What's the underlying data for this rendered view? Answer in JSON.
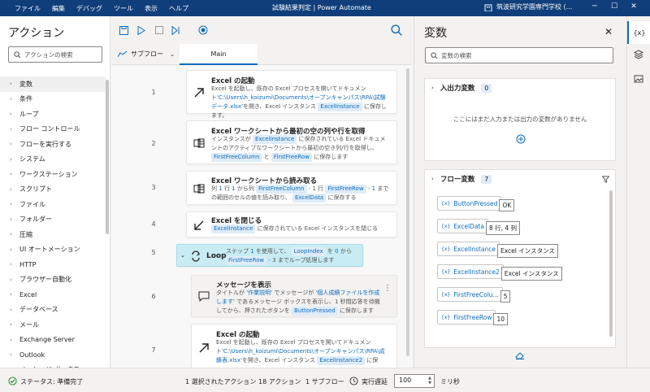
{
  "menu": [
    "ファイル",
    "編集",
    "デバッグ",
    "ツール",
    "表示",
    "ヘルプ"
  ],
  "window_title": "試験結果判定 | Power Automate",
  "account": "筑波研究学園専門学校 (...",
  "actions_panel": {
    "title": "アクション",
    "search_placeholder": "アクションの検索",
    "categories": [
      "変数",
      "条件",
      "ループ",
      "フロー コントロール",
      "フローを実行する",
      "システム",
      "ワークステーション",
      "スクリプト",
      "ファイル",
      "フォルダー",
      "圧縮",
      "UI オートメーション",
      "HTTP",
      "ブラウザー自動化",
      "Excel",
      "データベース",
      "メール",
      "Exchange Server",
      "Outlook",
      "メッセージ ボックス"
    ]
  },
  "editor": {
    "subflow_label": "サブフロー",
    "main_tab": "Main",
    "steps": [
      {
        "num": "1",
        "title": "Excel の起動",
        "line1": "Excel を起動し、既存の Excel プロセスを開いてドキュメント",
        "path1": "'C:\\Users\\h_koizumi\\Documents\\オープンキャンパス\\RPA\\試験データ.xlsx'",
        "line2": "を開き、Excel インスタンス",
        "var": "ExcelInstance",
        "line3": "に保存します。"
      },
      {
        "num": "2",
        "title": "Excel ワークシートから最初の空の列や行を取得",
        "t1": "インスタンスが",
        "v1": "ExcelInstance",
        "t2": "に保存されている Excel ドキュメントのアクティブなワークシートから最初の空き列/行を取得し、",
        "v2": "FirstFreeColumn",
        "t3": "と",
        "v3": "FirstFreeRow",
        "t4": "に保存します"
      },
      {
        "num": "3",
        "title": "Excel ワークシートから読み取る",
        "t1": "列",
        "n1": "1",
        "t2": "行",
        "n2": "1",
        "t3": "から列",
        "v1": "FirstFreeColumn",
        "t4": "- 1 行",
        "v2": "FirstFreeRow",
        "t5": "-",
        "n3": "1",
        "t6": "までの範囲のセルの値を読み取り、",
        "v3": "ExcelData",
        "t7": "に保存する"
      },
      {
        "num": "4",
        "title": "Excel を閉じる",
        "v1": "ExcelInstance",
        "t1": "に保存されている Excel インスタンスを閉じる"
      },
      {
        "num": "5",
        "title": "Loop",
        "t1": "ステップ",
        "n1": "1",
        "t2": "を使用して、",
        "v1": "LoopIndex",
        "t3": "を",
        "n2": "0",
        "t4": "から",
        "v2": "FirstFreeRow",
        "t5": "- 3 までループ処理します"
      },
      {
        "num": "6",
        "title": "メッセージを表示",
        "t1": "タイトルが",
        "s1": "'作業説明'",
        "t2": "でメッセージが",
        "s2": "'個人成績ファイルを作成します'",
        "t3": "であるメッセージ ボックスを表示し、1 秒間応答を待機してから、押されたボタンを",
        "v1": "ButtonPressed",
        "t4": "に保存します"
      },
      {
        "num": "7",
        "title": "Excel の起動",
        "line1": "Excel を起動し、既存の Excel プロセスを開いてドキュメント",
        "path1": "'C:\\Users\\h_koizumi\\Documents\\オープンキャンパス\\RPA\\成績表.xlsx'",
        "line2": "を開き、Excel インスタンス",
        "var": "ExcelInstance2",
        "line3": "に保"
      }
    ]
  },
  "variables_panel": {
    "title": "変数",
    "search_placeholder": "変数の検索",
    "io_section": {
      "title": "入出力変数",
      "count": "0",
      "empty_text": "ここにはまだ入力または出力の変数がありません"
    },
    "flow_section": {
      "title": "フロー変数",
      "count": "7"
    },
    "flow_vars": [
      {
        "name": "ButtonPressed",
        "value": "OK"
      },
      {
        "name": "ExcelData",
        "value": "8 行, 4 列"
      },
      {
        "name": "ExcelInstance",
        "value": "Excel インスタンス"
      },
      {
        "name": "ExcelInstance2",
        "value": "Excel インスタンス"
      },
      {
        "name": "FirstFreeColu...",
        "value": "5"
      },
      {
        "name": "FirstFreeRow",
        "value": "10"
      }
    ]
  },
  "status": {
    "state": "ステータス: 準備完了",
    "selected": "1 選択されたアクション",
    "actions": "18 アクション",
    "subflows": "1 サブフロー",
    "delay_label": "実行遅延",
    "delay_value": "100",
    "delay_unit": "ミリ秒"
  }
}
